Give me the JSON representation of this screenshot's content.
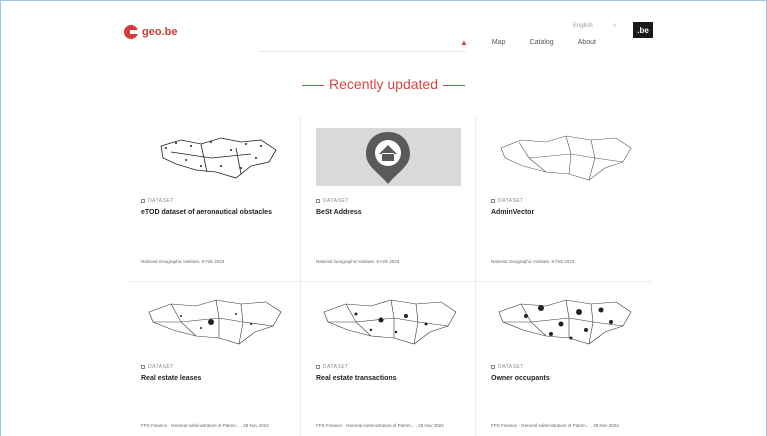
{
  "header": {
    "logo_text": "geo.be",
    "nav": {
      "map": "Map",
      "catalog": "Catalog",
      "about": "About"
    },
    "language": "English",
    "be_badge": ".be"
  },
  "section": {
    "title": "Recently updated"
  },
  "cards": [
    {
      "type": "DATASET",
      "title": "eTOD dataset of aeronautical obstacles",
      "meta": "National Geographic Institute, 8 Feb 2023"
    },
    {
      "type": "DATASET",
      "title": "BeSt Address",
      "meta": "National Geographic Institute, 6 Feb 2023"
    },
    {
      "type": "DATASET",
      "title": "AdminVector",
      "meta": "National Geographic Institute, 6 Feb 2023"
    },
    {
      "type": "DATASET",
      "title": "Real estate leases",
      "meta": "FPS Finance - General Administration of Patrim... , 28 Nov 2022"
    },
    {
      "type": "DATASET",
      "title": "Real estate transactions",
      "meta": "FPS Finance - General Administration of Patrim... , 28 Nov 2022"
    },
    {
      "type": "DATASET",
      "title": "Owner occupants",
      "meta": "FPS Finance - General Administration of Patrim... , 28 Nov 2022"
    }
  ],
  "colors": {
    "accent": "#d64545"
  }
}
